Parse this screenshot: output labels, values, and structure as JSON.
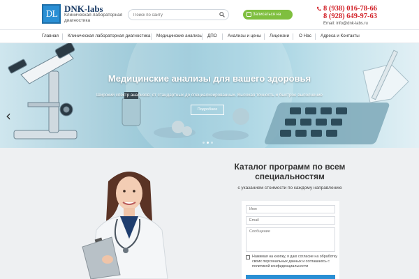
{
  "header": {
    "logo_mark": "DL",
    "brand": "DNK-labs",
    "tagline": "Клиническая лабораторная диагностика",
    "search": {
      "placeholder": "Поиск по сайту"
    },
    "signup_label": "Записаться на прием",
    "phone1": "8 (938) 016-78-66",
    "phone2": "8 (928) 649-97-63",
    "email": "Email: info@dnk-labs.ru"
  },
  "nav": {
    "items": [
      "Главная",
      "Клиническая лабораторная диагностика",
      "Медицинские анализы",
      "ДПО",
      "Анализы и цены",
      "Лицензии",
      "О Нас",
      "Адреса и Контакты"
    ]
  },
  "hero": {
    "title": "Медицинские анализы для вашего здоровья",
    "subtitle": "Широкий спектр анализов: от стандартных до специализированных. Высокая точность и быстрое выполнение",
    "button": "Подробнее"
  },
  "catalog": {
    "title": "Каталог программ по всем специальностям",
    "subtitle": "с указанием стоимости по каждому направлению",
    "form": {
      "name_placeholder": "Имя",
      "email_placeholder": "Email",
      "message_placeholder": "Сообщение",
      "consent": "Нажимая на кнопку, я даю согласие на обработку своих персональных данных и соглашаюсь с политикой конфиденциальности"
    }
  },
  "colors": {
    "brand_blue": "#2a8fd4",
    "phone_red": "#d2232a",
    "signup_green": "#7fbf3f"
  }
}
